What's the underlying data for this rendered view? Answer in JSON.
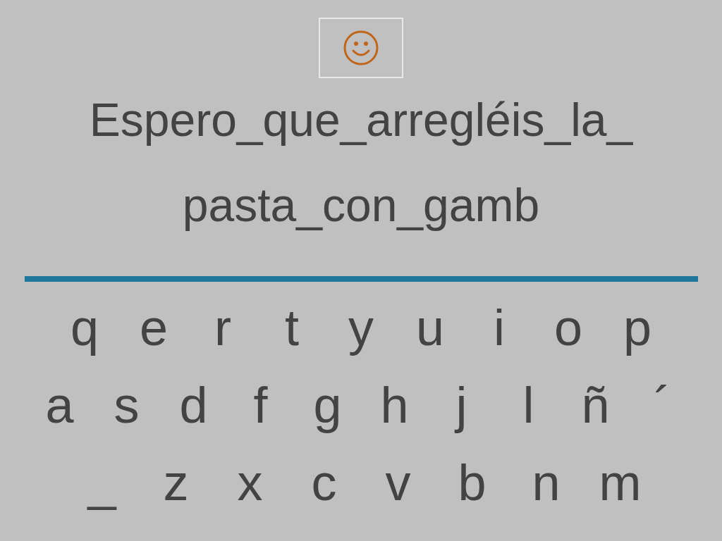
{
  "sentence_lines": [
    "Espero_que_arregléis_la_",
    "pasta_con_gamb"
  ],
  "keyboard": {
    "rows": [
      [
        "q",
        "e",
        "r",
        "t",
        "y",
        "u",
        "i",
        "o",
        "p"
      ],
      [
        "a",
        "s",
        "d",
        "f",
        "g",
        "h",
        "j",
        "l",
        "ñ",
        "´"
      ],
      [
        "_",
        "z",
        "x",
        "c",
        "v",
        "b",
        "n",
        "m"
      ]
    ]
  }
}
